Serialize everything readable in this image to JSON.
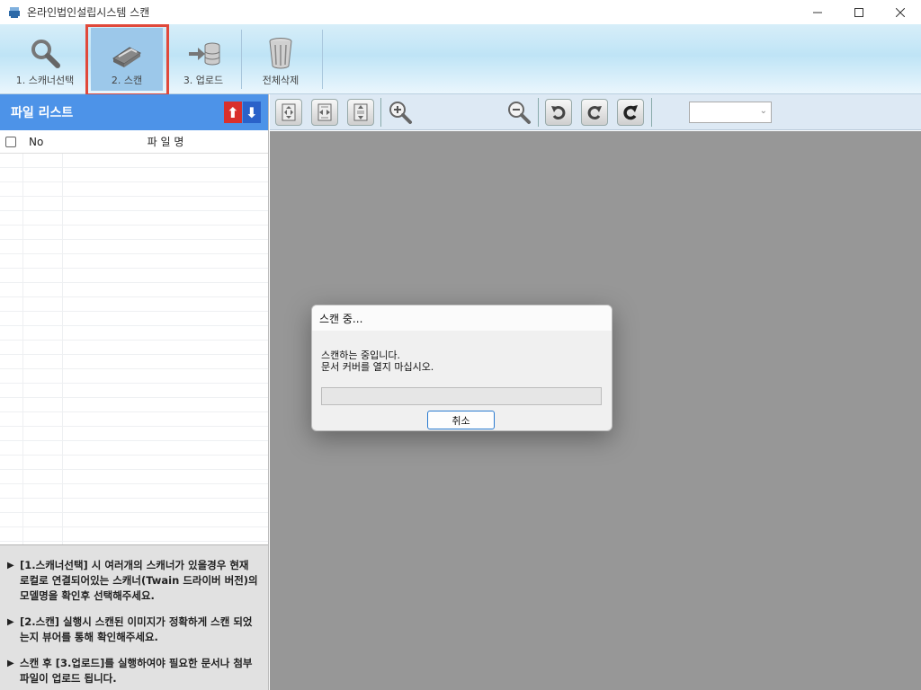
{
  "window": {
    "title": "온라인법인설립시스템 스캔",
    "minimize_icon": "minimize-icon",
    "maximize_icon": "maximize-icon",
    "close_icon": "close-icon"
  },
  "toolbar": {
    "buttons": [
      {
        "label": "1. 스캐너선택",
        "icon": "magnifier-icon"
      },
      {
        "label": "2. 스캔",
        "icon": "scanner-icon",
        "selected": true
      },
      {
        "label": "3. 업로드",
        "icon": "upload-database-icon"
      },
      {
        "label": "전체삭제",
        "icon": "trash-icon"
      }
    ],
    "highlight_color": "#e0493b"
  },
  "file_list": {
    "title": "파일 리스트",
    "sort_up_icon": "arrow-up-icon",
    "sort_down_icon": "arrow-down-icon",
    "columns": {
      "no": "No",
      "name": "파 일 명"
    },
    "rows": []
  },
  "help": {
    "items": [
      "[1.스캐너선택] 시 여러개의 스캐너가 있을경우 현재 로컬로 연결되어있는 스캐너(Twain 드라이버 버전)의 모델명을 확인후 선택해주세요.",
      "[2.스캔] 실행시 스캔된 이미지가 정확하게 스캔 되었는지 뷰어를 통해 확인해주세요.",
      "스캔 후 [3.업로드]를 실행하여야 필요한 문서나 첨부파일이 업로드 됩니다."
    ]
  },
  "viewer_toolbar": {
    "buttons": [
      "fit-page-icon",
      "fit-width-icon",
      "fit-height-icon",
      "zoom-in-icon",
      "zoom-out-icon",
      "rotate-left-icon",
      "rotate-right-icon",
      "rotate-180-icon"
    ],
    "zoom_value": ""
  },
  "dialog": {
    "title": "스캔 중...",
    "message_line1": "스캔하는 중입니다.",
    "message_line2": "문서 커버를 열지 마십시오.",
    "progress": 0,
    "cancel_label": "취소"
  },
  "colors": {
    "list_header": "#4d93e8",
    "canvas": "#979797",
    "dialog_button_border": "#2a7bd0"
  }
}
